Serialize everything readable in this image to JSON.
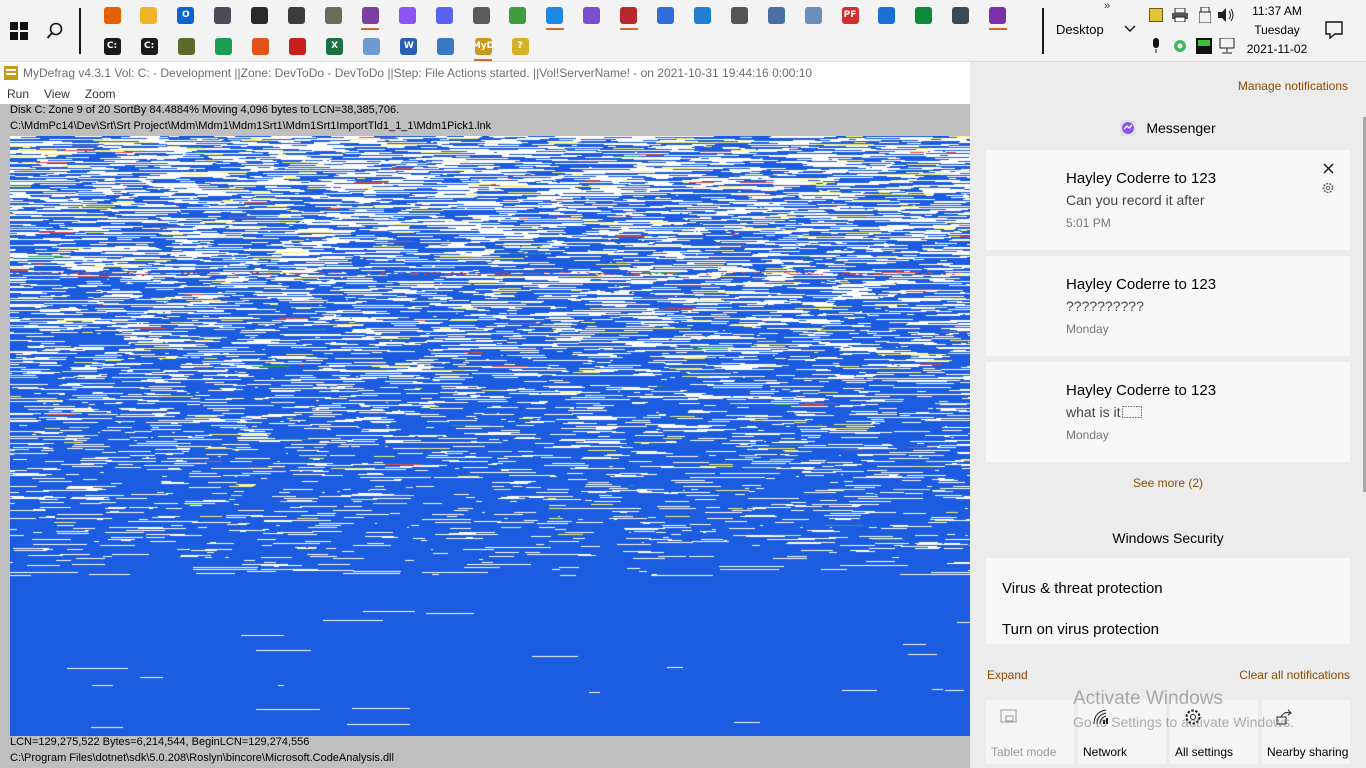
{
  "taskbar": {
    "apps_row1": [
      {
        "name": "firefox-icon",
        "color": "#e66000",
        "glyph": "",
        "running": false
      },
      {
        "name": "file-explorer-icon",
        "color": "#f0b429",
        "glyph": "",
        "running": false
      },
      {
        "name": "outlook-icon",
        "color": "#0a64d2",
        "glyph": "O",
        "running": false
      },
      {
        "name": "services-icon",
        "color": "#4a4f57",
        "glyph": "",
        "running": false
      },
      {
        "name": "terminal-icon",
        "color": "#2a2a2a",
        "glyph": "",
        "running": false
      },
      {
        "name": "scanner-icon",
        "color": "#3c3c3c",
        "glyph": "",
        "running": false
      },
      {
        "name": "gimp-icon",
        "color": "#6b6b5a",
        "glyph": "",
        "running": false
      },
      {
        "name": "calculator-icon",
        "color": "#7b3fa0",
        "glyph": "",
        "running": true
      },
      {
        "name": "messenger-icon",
        "color": "#8a55f0",
        "glyph": "",
        "running": false
      },
      {
        "name": "discord-icon",
        "color": "#5865f2",
        "glyph": "",
        "running": false
      },
      {
        "name": "clock-app-icon",
        "color": "#5a5a5a",
        "glyph": "",
        "running": false
      },
      {
        "name": "paint-icon",
        "color": "#3f9b3f",
        "glyph": "",
        "running": false
      },
      {
        "name": "vscode-icon",
        "color": "#1e88e5",
        "glyph": "",
        "running": true
      },
      {
        "name": "visual-studio-icon",
        "color": "#7c4dcc",
        "glyph": "",
        "running": false
      },
      {
        "name": "git-tool-icon",
        "color": "#b8272c",
        "glyph": "",
        "running": true
      },
      {
        "name": "powershell-icon",
        "color": "#2f6fd6",
        "glyph": "",
        "running": false
      },
      {
        "name": "calculator-grid-icon",
        "color": "#1f7fd1",
        "glyph": "",
        "running": false
      },
      {
        "name": "settings-app-icon",
        "color": "#555555",
        "glyph": "",
        "running": false
      },
      {
        "name": "remote-desktop-icon",
        "color": "#4a6fa0",
        "glyph": "",
        "running": false
      },
      {
        "name": "monitor-app-icon",
        "color": "#6a8fb8",
        "glyph": "",
        "running": false
      },
      {
        "name": "pdf-reader-icon",
        "color": "#d22f2f",
        "glyph": "PF",
        "running": false
      },
      {
        "name": "todo-icon",
        "color": "#1a6fd6",
        "glyph": "",
        "running": false
      },
      {
        "name": "green-app-icon",
        "color": "#0b8a3a",
        "glyph": "",
        "running": false
      },
      {
        "name": "photo-app-icon",
        "color": "#3c4a58",
        "glyph": "",
        "running": false
      },
      {
        "name": "onenote-icon",
        "color": "#7b2fa8",
        "glyph": "",
        "running": true
      }
    ],
    "apps_row2": [
      {
        "name": "cmd-icon",
        "color": "#1a1a1a",
        "glyph": "C:",
        "running": false
      },
      {
        "name": "cmd-admin-icon",
        "color": "#1a1a1a",
        "glyph": "C:",
        "running": false
      },
      {
        "name": "tree-app-icon",
        "color": "#5c6b2c",
        "glyph": "",
        "running": false
      },
      {
        "name": "chrome-icon",
        "color": "#1a9f53",
        "glyph": "",
        "running": false
      },
      {
        "name": "office-icon",
        "color": "#e2531b",
        "glyph": "",
        "running": false
      },
      {
        "name": "acrobat-icon",
        "color": "#c8201d",
        "glyph": "",
        "running": false
      },
      {
        "name": "excel-icon",
        "color": "#1d7044",
        "glyph": "X",
        "running": false
      },
      {
        "name": "notepad-icon",
        "color": "#6c9bd2",
        "glyph": "",
        "running": false
      },
      {
        "name": "word-icon",
        "color": "#2b5fb3",
        "glyph": "W",
        "running": false
      },
      {
        "name": "document-icon",
        "color": "#3a78c4",
        "glyph": "",
        "running": false
      },
      {
        "name": "mydefrag-icon",
        "color": "#c89b1f",
        "glyph": "MyD",
        "running": true
      },
      {
        "name": "help-icon",
        "color": "#d5b12a",
        "glyph": "?",
        "running": false
      }
    ],
    "desktop_label": "Desktop",
    "clock": {
      "time": "11:37 AM",
      "day": "Tuesday",
      "date": "2021-11-02"
    }
  },
  "app": {
    "title": "MyDefrag v4.3.1    Vol: C: - Development ||Zone: DevToDo - DevToDo ||Step: File Actions started. ||Vol!ServerName! -   on 2021-10-31 19:44:16 0:00:10",
    "menu": [
      "Run",
      "View",
      "Zoom"
    ],
    "status_top": "Disk C:    Zone 9 of 20    SortBy    84.4884%    Moving 4,096 bytes to LCN=38,385,706.",
    "path_top": "C:\\MdmPc14\\Dev\\Srt\\Srt Project\\Mdm\\Mdm1\\Mdm1Srt1\\Mdm1Srt1ImportTld1_1_1\\Mdm1Pick1.lnk",
    "status_bottom": "LCN=129,275,522      Bytes=6,214,544, BeginLCN=129,274,556",
    "path_bottom": "C:\\Program Files\\dotnet\\sdk\\5.0.208\\Roslyn\\bincore\\Microsoft.CodeAnalysis.dll",
    "map_colors": {
      "free": "#1c5ce0",
      "used": "#ffffff",
      "fragmented": "#f4f07a",
      "busy": "#e24b3a",
      "system": "#2ea84a"
    }
  },
  "notifications": {
    "manage": "Manage notifications",
    "messenger": {
      "app": "Messenger",
      "items": [
        {
          "title": "Hayley Coderre to 123",
          "body": "Can you record it after",
          "time": "5:01 PM"
        },
        {
          "title": "Hayley Coderre to 123",
          "body": "??????????",
          "time": "Monday"
        },
        {
          "title": "Hayley Coderre to 123",
          "body": "what is it",
          "time": "Monday"
        }
      ],
      "see_more": "See more (2)"
    },
    "security": {
      "app": "Windows Security",
      "line1": "Virus & threat protection",
      "line2": "Turn on virus protection"
    },
    "expand": "Expand",
    "clear": "Clear all notifications",
    "quick_actions": [
      {
        "label": "Tablet mode",
        "icon": "tablet-mode-icon",
        "enabled": false
      },
      {
        "label": "Network",
        "icon": "network-icon",
        "enabled": true
      },
      {
        "label": "All settings",
        "icon": "settings-gear-icon",
        "enabled": true
      },
      {
        "label": "Nearby sharing",
        "icon": "nearby-sharing-icon",
        "enabled": true
      }
    ],
    "watermark_title": "Activate Windows",
    "watermark_sub": "Go to Settings to activate Windows."
  }
}
